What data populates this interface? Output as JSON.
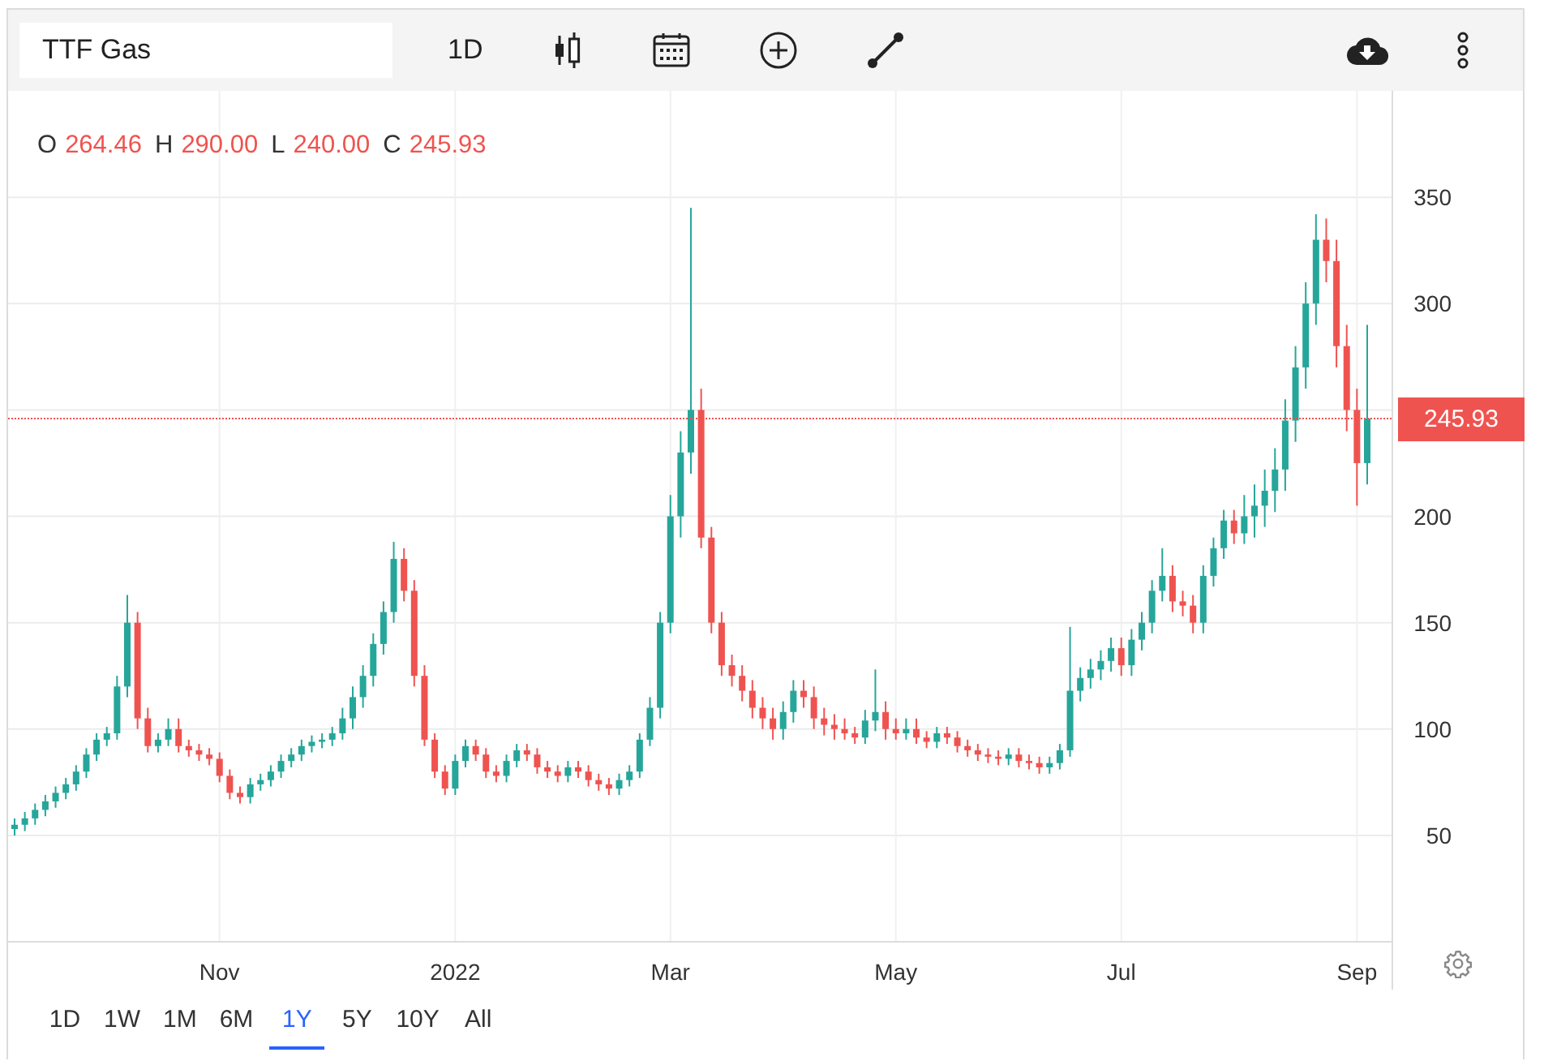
{
  "toolbar": {
    "symbol": "TTF Gas",
    "interval": "1D"
  },
  "ohlc": [
    {
      "key": "O",
      "value": "264.46"
    },
    {
      "key": "H",
      "value": "290.00"
    },
    {
      "key": "L",
      "value": "240.00"
    },
    {
      "key": "C",
      "value": "245.93"
    }
  ],
  "chart": {
    "chart_data": {
      "type": "candlestick",
      "grid": true,
      "yticks": [
        50,
        100,
        150,
        200,
        300,
        350
      ],
      "ylim": [
        0,
        400
      ],
      "ref_lines": [
        {
          "axis": "y",
          "value": 245.93,
          "label": "245.93",
          "color": "#ef5350"
        }
      ],
      "categories": [
        null,
        null,
        null,
        null,
        null,
        null,
        null,
        null,
        null,
        null,
        null,
        null,
        null,
        null,
        null,
        null,
        null,
        null,
        null,
        null,
        "Nov",
        null,
        null,
        null,
        null,
        null,
        null,
        null,
        null,
        null,
        null,
        null,
        null,
        null,
        null,
        null,
        null,
        null,
        null,
        null,
        null,
        null,
        null,
        "2022",
        null,
        null,
        null,
        null,
        null,
        null,
        null,
        null,
        null,
        null,
        null,
        null,
        null,
        null,
        null,
        null,
        null,
        null,
        null,
        null,
        "Mar",
        null,
        null,
        null,
        null,
        null,
        null,
        null,
        null,
        null,
        null,
        null,
        null,
        null,
        null,
        null,
        null,
        null,
        null,
        null,
        null,
        null,
        "May",
        null,
        null,
        null,
        null,
        null,
        null,
        null,
        null,
        null,
        null,
        null,
        null,
        null,
        null,
        null,
        null,
        null,
        null,
        null,
        null,
        null,
        "Jul",
        null,
        null,
        null,
        null,
        null,
        null,
        null,
        null,
        null,
        null,
        null,
        null,
        null,
        null,
        null,
        null,
        null,
        null,
        null,
        null,
        null,
        null,
        "Sep",
        null
      ],
      "ohlc": [
        [
          53,
          58,
          50,
          55
        ],
        [
          55,
          61,
          52,
          58
        ],
        [
          58,
          65,
          55,
          62
        ],
        [
          62,
          69,
          59,
          66
        ],
        [
          66,
          73,
          63,
          70
        ],
        [
          70,
          77,
          67,
          74
        ],
        [
          74,
          83,
          71,
          80
        ],
        [
          80,
          91,
          77,
          88
        ],
        [
          88,
          98,
          85,
          95
        ],
        [
          95,
          101,
          92,
          98
        ],
        [
          98,
          125,
          95,
          120
        ],
        [
          120,
          163,
          115,
          150
        ],
        [
          150,
          155,
          100,
          105
        ],
        [
          105,
          110,
          89,
          92
        ],
        [
          92,
          98,
          89,
          95
        ],
        [
          95,
          105,
          92,
          100
        ],
        [
          100,
          105,
          89,
          92
        ],
        [
          92,
          95,
          87,
          90
        ],
        [
          90,
          93,
          85,
          88
        ],
        [
          88,
          91,
          83,
          86
        ],
        [
          86,
          89,
          75,
          78
        ],
        [
          78,
          81,
          67,
          70
        ],
        [
          70,
          73,
          65,
          68
        ],
        [
          68,
          77,
          65,
          74
        ],
        [
          74,
          79,
          71,
          76
        ],
        [
          76,
          83,
          73,
          80
        ],
        [
          80,
          88,
          77,
          85
        ],
        [
          85,
          91,
          82,
          88
        ],
        [
          88,
          95,
          85,
          92
        ],
        [
          92,
          97,
          89,
          94
        ],
        [
          94,
          98,
          91,
          95
        ],
        [
          95,
          101,
          92,
          98
        ],
        [
          98,
          110,
          95,
          105
        ],
        [
          105,
          120,
          100,
          115
        ],
        [
          115,
          130,
          110,
          125
        ],
        [
          125,
          145,
          120,
          140
        ],
        [
          140,
          160,
          135,
          155
        ],
        [
          155,
          188,
          150,
          180
        ],
        [
          180,
          185,
          160,
          165
        ],
        [
          165,
          170,
          120,
          125
        ],
        [
          125,
          130,
          92,
          95
        ],
        [
          95,
          98,
          77,
          80
        ],
        [
          80,
          83,
          69,
          72
        ],
        [
          72,
          88,
          69,
          85
        ],
        [
          85,
          95,
          82,
          92
        ],
        [
          92,
          95,
          85,
          88
        ],
        [
          88,
          91,
          77,
          80
        ],
        [
          80,
          83,
          75,
          78
        ],
        [
          78,
          88,
          75,
          85
        ],
        [
          85,
          93,
          82,
          90
        ],
        [
          90,
          93,
          85,
          88
        ],
        [
          88,
          91,
          79,
          82
        ],
        [
          82,
          85,
          77,
          80
        ],
        [
          80,
          83,
          75,
          78
        ],
        [
          78,
          85,
          75,
          82
        ],
        [
          82,
          85,
          77,
          80
        ],
        [
          80,
          83,
          73,
          76
        ],
        [
          76,
          79,
          71,
          74
        ],
        [
          74,
          77,
          69,
          72
        ],
        [
          72,
          79,
          69,
          76
        ],
        [
          76,
          83,
          73,
          80
        ],
        [
          80,
          98,
          77,
          95
        ],
        [
          95,
          115,
          92,
          110
        ],
        [
          110,
          155,
          105,
          150
        ],
        [
          150,
          210,
          145,
          200
        ],
        [
          200,
          240,
          190,
          230
        ],
        [
          230,
          345,
          220,
          250
        ],
        [
          250,
          260,
          185,
          190
        ],
        [
          190,
          195,
          145,
          150
        ],
        [
          150,
          155,
          125,
          130
        ],
        [
          130,
          135,
          120,
          125
        ],
        [
          125,
          130,
          113,
          118
        ],
        [
          118,
          123,
          105,
          110
        ],
        [
          110,
          115,
          100,
          105
        ],
        [
          105,
          110,
          95,
          100
        ],
        [
          100,
          113,
          95,
          108
        ],
        [
          108,
          123,
          103,
          118
        ],
        [
          118,
          123,
          110,
          115
        ],
        [
          115,
          120,
          100,
          105
        ],
        [
          105,
          110,
          97,
          102
        ],
        [
          102,
          107,
          95,
          100
        ],
        [
          100,
          105,
          95,
          98
        ],
        [
          98,
          101,
          93,
          96
        ],
        [
          96,
          109,
          93,
          104
        ],
        [
          104,
          128,
          99,
          108
        ],
        [
          108,
          113,
          95,
          100
        ],
        [
          100,
          105,
          95,
          98
        ],
        [
          98,
          105,
          95,
          100
        ],
        [
          100,
          105,
          93,
          96
        ],
        [
          96,
          99,
          91,
          94
        ],
        [
          94,
          101,
          91,
          98
        ],
        [
          98,
          101,
          93,
          96
        ],
        [
          96,
          99,
          89,
          92
        ],
        [
          92,
          95,
          87,
          90
        ],
        [
          90,
          93,
          85,
          88
        ],
        [
          88,
          91,
          84,
          87
        ],
        [
          87,
          90,
          83,
          86
        ],
        [
          86,
          91,
          83,
          88
        ],
        [
          88,
          91,
          82,
          85
        ],
        [
          85,
          88,
          81,
          84
        ],
        [
          84,
          87,
          79,
          82
        ],
        [
          82,
          87,
          79,
          84
        ],
        [
          84,
          93,
          81,
          90
        ],
        [
          90,
          148,
          87,
          118
        ],
        [
          118,
          129,
          113,
          124
        ],
        [
          124,
          133,
          119,
          128
        ],
        [
          128,
          137,
          123,
          132
        ],
        [
          132,
          143,
          127,
          138
        ],
        [
          138,
          143,
          125,
          130
        ],
        [
          130,
          147,
          125,
          142
        ],
        [
          142,
          155,
          137,
          150
        ],
        [
          150,
          170,
          145,
          165
        ],
        [
          165,
          185,
          160,
          172
        ],
        [
          172,
          177,
          155,
          160
        ],
        [
          160,
          165,
          153,
          158
        ],
        [
          158,
          163,
          145,
          150
        ],
        [
          150,
          177,
          145,
          172
        ],
        [
          172,
          190,
          167,
          185
        ],
        [
          185,
          203,
          180,
          198
        ],
        [
          198,
          203,
          187,
          192
        ],
        [
          192,
          210,
          187,
          200
        ],
        [
          200,
          215,
          190,
          205
        ],
        [
          205,
          222,
          195,
          212
        ],
        [
          212,
          232,
          202,
          222
        ],
        [
          222,
          255,
          212,
          245
        ],
        [
          245,
          280,
          235,
          270
        ],
        [
          270,
          310,
          260,
          300
        ],
        [
          300,
          342,
          290,
          330
        ],
        [
          330,
          340,
          310,
          320
        ],
        [
          320,
          330,
          270,
          280
        ],
        [
          280,
          290,
          240,
          250
        ],
        [
          250,
          260,
          205,
          225
        ],
        [
          225,
          290,
          215,
          246
        ]
      ]
    }
  },
  "ranges": [
    {
      "label": "1D",
      "selected": false
    },
    {
      "label": "1W",
      "selected": false
    },
    {
      "label": "1M",
      "selected": false
    },
    {
      "label": "6M",
      "selected": false
    },
    {
      "label": "1Y",
      "selected": true
    },
    {
      "label": "5Y",
      "selected": false
    },
    {
      "label": "10Y",
      "selected": false
    },
    {
      "label": "All",
      "selected": false
    }
  ]
}
